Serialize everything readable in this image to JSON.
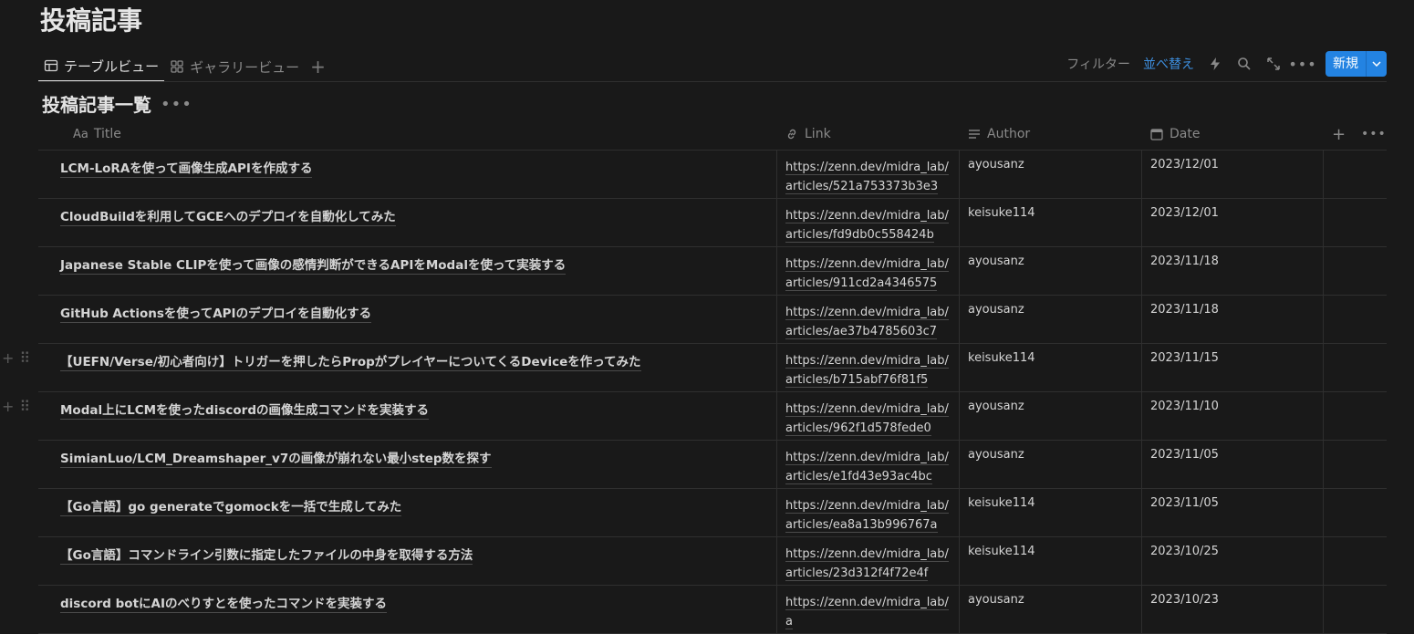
{
  "page": {
    "title": "投稿記事"
  },
  "tabs": [
    {
      "label": "テーブルビュー",
      "icon": "table-icon",
      "active": true
    },
    {
      "label": "ギャラリービュー",
      "icon": "gallery-icon",
      "active": false
    }
  ],
  "toolbar": {
    "filter_label": "フィルター",
    "sort_label": "並べ替え",
    "new_label": "新規",
    "accent": "#2383e2",
    "sort_color": "#3d8fe0"
  },
  "database": {
    "title": "投稿記事一覧"
  },
  "columns": [
    {
      "label": "Title",
      "icon": "title-aa-icon"
    },
    {
      "label": "Link",
      "icon": "link-icon"
    },
    {
      "label": "Author",
      "icon": "text-lines-icon"
    },
    {
      "label": "Date",
      "icon": "calendar-icon"
    }
  ],
  "rows": [
    {
      "title": "LCM-LoRAを使って画像生成APIを作成する",
      "link": "https://zenn.dev/midra_lab/articles/521a753373b3e3",
      "author": "ayousanz",
      "date": "2023/12/01"
    },
    {
      "title": "CloudBuildを利用してGCEへのデプロイを自動化してみた",
      "link": "https://zenn.dev/midra_lab/articles/fd9db0c558424b",
      "author": "keisuke114",
      "date": "2023/12/01"
    },
    {
      "title": "Japanese Stable CLIPを使って画像の感情判断ができるAPIをModalを使って実装する",
      "link": "https://zenn.dev/midra_lab/articles/911cd2a4346575",
      "author": "ayousanz",
      "date": "2023/11/18"
    },
    {
      "title": "GitHub Actionsを使ってAPIのデプロイを自動化する",
      "link": "https://zenn.dev/midra_lab/articles/ae37b4785603c7",
      "author": "ayousanz",
      "date": "2023/11/18"
    },
    {
      "title": "【UEFN/Verse/初心者向け】トリガーを押したらPropがプレイヤーについてくるDeviceを作ってみた",
      "link": "https://zenn.dev/midra_lab/articles/b715abf76f81f5",
      "author": "keisuke114",
      "date": "2023/11/15"
    },
    {
      "title": "Modal上にLCMを使ったdiscordの画像生成コマンドを実装する",
      "link": "https://zenn.dev/midra_lab/articles/962f1d578fede0",
      "author": "ayousanz",
      "date": "2023/11/10"
    },
    {
      "title": "SimianLuo/LCM_Dreamshaper_v7の画像が崩れない最小step数を探す",
      "link": "https://zenn.dev/midra_lab/articles/e1fd43e93ac4bc",
      "author": "ayousanz",
      "date": "2023/11/05"
    },
    {
      "title": "【Go言語】go generateでgomockを一括で生成してみた",
      "link": "https://zenn.dev/midra_lab/articles/ea8a13b996767a",
      "author": "keisuke114",
      "date": "2023/11/05"
    },
    {
      "title": "【Go言語】コマンドライン引数に指定したファイルの中身を取得する方法",
      "link": "https://zenn.dev/midra_lab/articles/23d312f4f72e4f",
      "author": "keisuke114",
      "date": "2023/10/25"
    },
    {
      "title": "discord botにAIのべりすとを使ったコマンドを実装する",
      "link": "https://zenn.dev/midra_lab/a",
      "author": "ayousanz",
      "date": "2023/10/23"
    }
  ]
}
